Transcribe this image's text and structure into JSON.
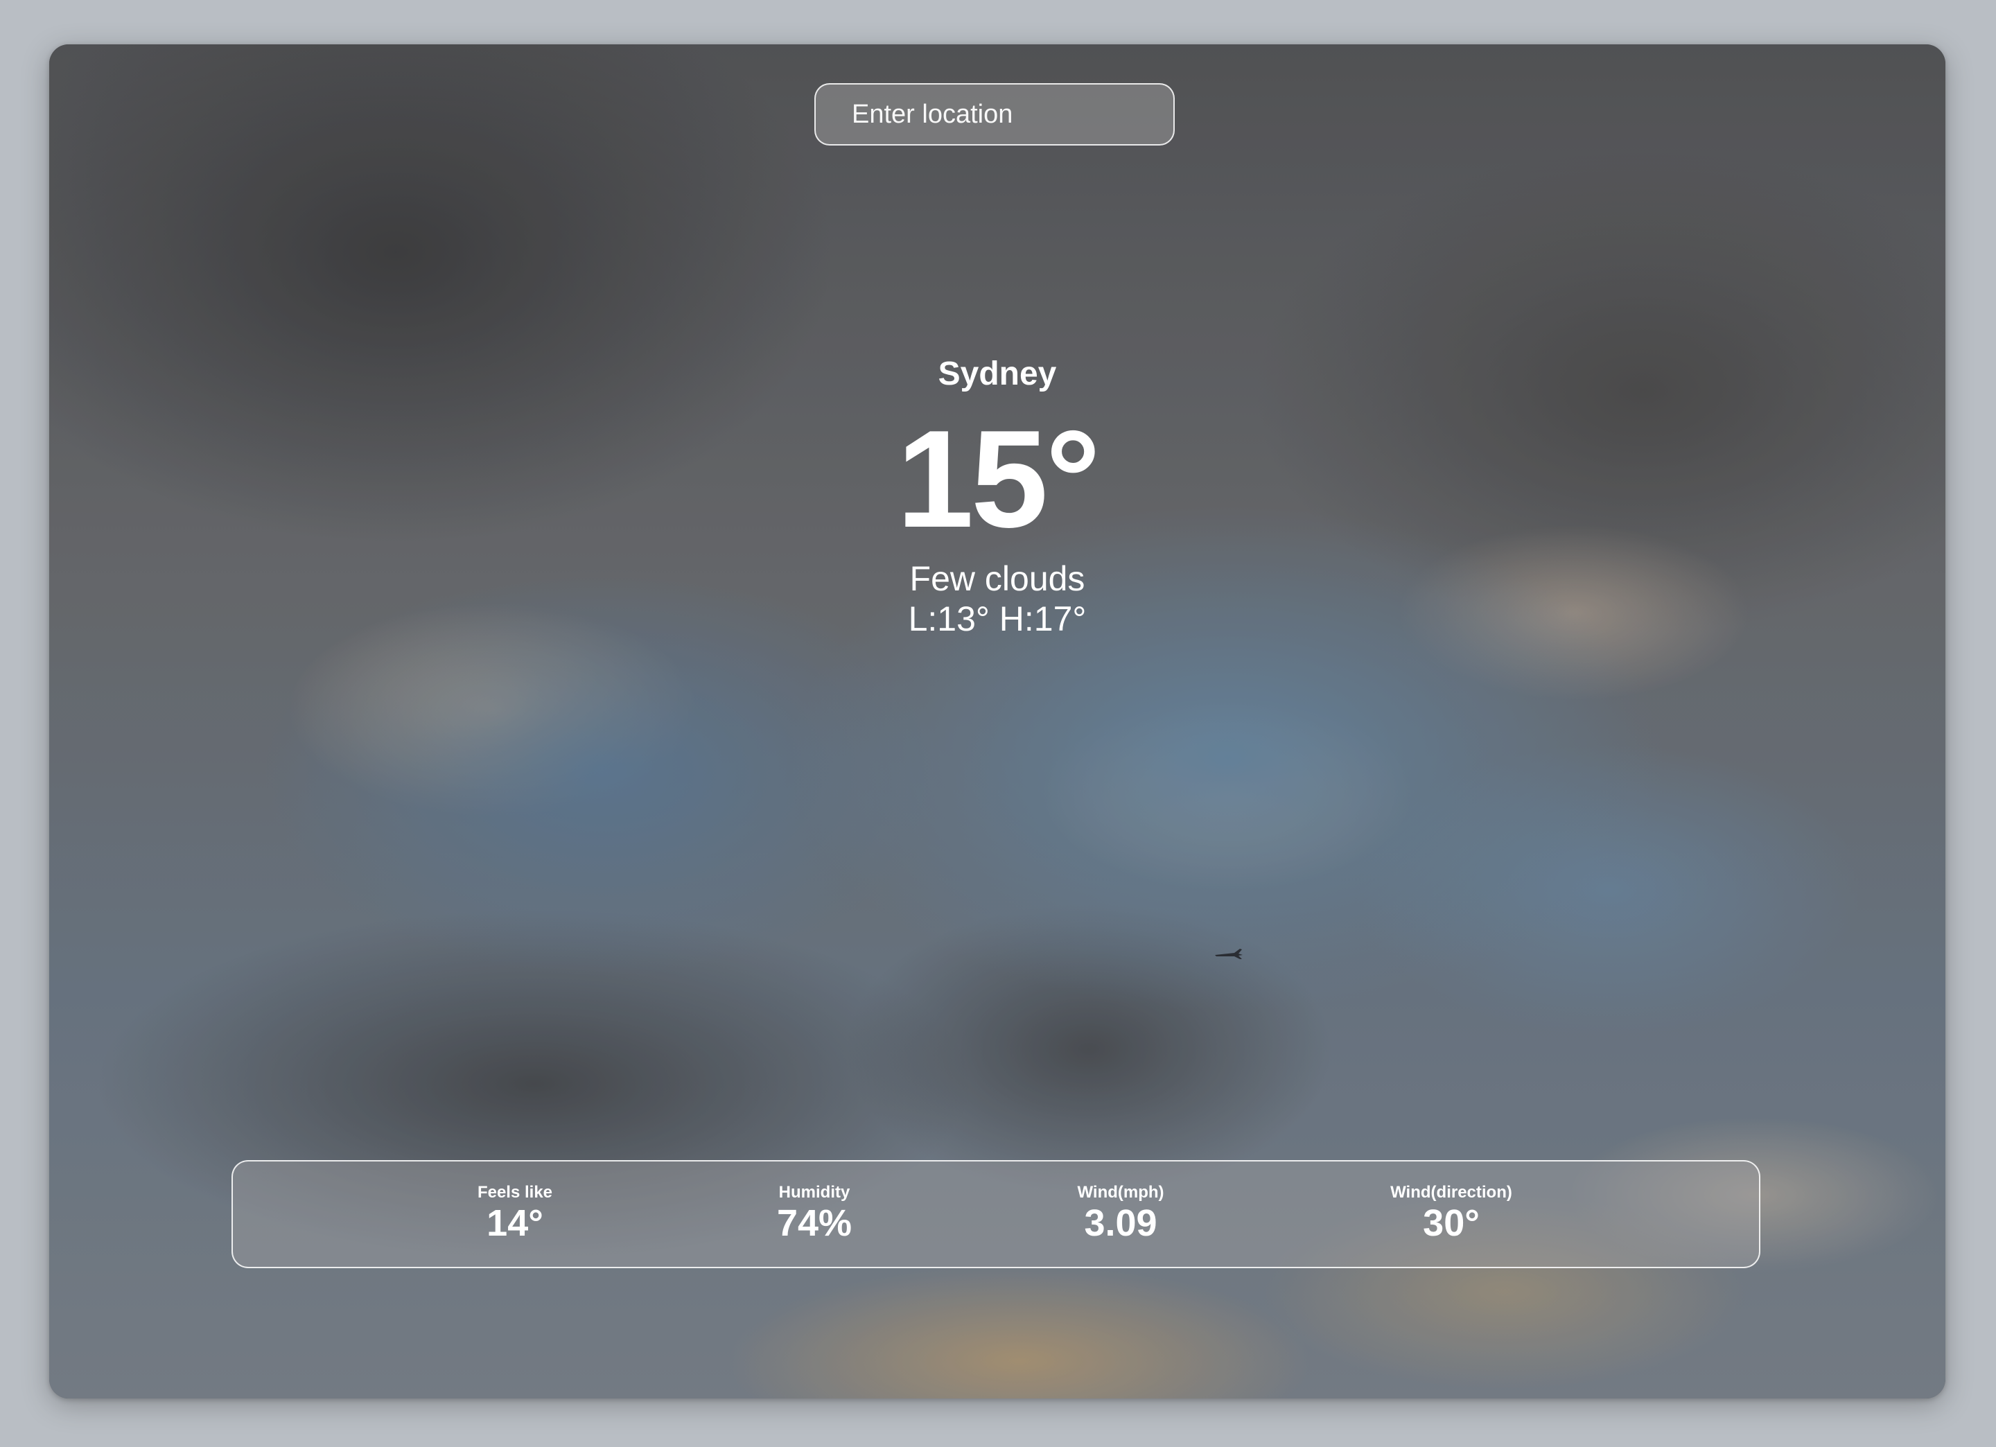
{
  "search": {
    "placeholder": "Enter location",
    "value": ""
  },
  "current": {
    "city": "Sydney",
    "temperature": "15°",
    "description": "Few clouds",
    "low_high": "L:13° H:17°"
  },
  "stats": [
    {
      "label": "Feels like",
      "value": "14°"
    },
    {
      "label": "Humidity",
      "value": "74%"
    },
    {
      "label": "Wind(mph)",
      "value": "3.09"
    },
    {
      "label": "Wind(direction)",
      "value": "30°"
    }
  ]
}
